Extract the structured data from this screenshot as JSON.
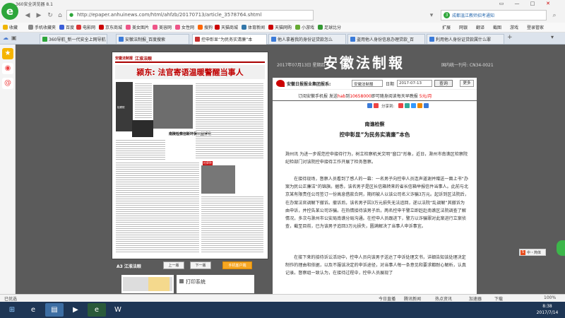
{
  "browser": {
    "title": "360安全浏览器 8.1",
    "url": "http://epaper.anhuinews.com/html/ahfzb/20170713/article_3578764.shtml",
    "search_query": "成都温江教师招考通知",
    "window_controls": [
      "▭",
      "—",
      "□",
      "✕"
    ]
  },
  "bookmarks": {
    "label": "收藏",
    "items": [
      "手机收藏夹",
      "百度",
      "电影网",
      "京东商城",
      "美女图片",
      "美容网",
      "女性网",
      "搜狗",
      "天猫商城",
      "体育新闻",
      "天猫网购",
      "小游戏",
      "足球比分"
    ],
    "right_items": [
      "扩展",
      "网银",
      "翻译",
      "截图",
      "游戏",
      "登录管家"
    ]
  },
  "tabs": [
    {
      "label": "360导航_新一代安全上网导航",
      "active": false,
      "color": "#2da63a"
    },
    {
      "label": "安徽法制报_百度搜索",
      "active": false,
      "color": "#3b7bd9"
    },
    {
      "label": "控申彰显“为民务实清廉”本",
      "active": true,
      "color": "#c83232"
    },
    {
      "label": "他人拿着我的身份证贷款怎么",
      "active": false,
      "color": "#3b7bd9"
    },
    {
      "label": "盗用他人身份信息办理贷款_百",
      "active": false,
      "color": "#3b7bd9"
    },
    {
      "label": "利用他人身份证贷款属什么罪",
      "active": false,
      "color": "#3b7bd9"
    }
  ],
  "sidebar_icons": [
    "star-icon",
    "weibo-icon",
    "mail-icon"
  ],
  "newspaper": {
    "masthead_left": "安徽法制报",
    "masthead_section": "江淮法眼",
    "headline": "颍东: 法官寄语温暖警醒当事人",
    "sub_headline": "南陵检察创新环保公益诉讼",
    "photo_tag": "检察院",
    "side_caption": "检察院连续上门走访对接小微企业"
  },
  "page_controls": {
    "page_label": "A3 江淮法眼",
    "prev": "上一版",
    "next": "下一版",
    "mobile": "手机客户端"
  },
  "print_label": "打印系统",
  "site_header": {
    "date": "2017年07月13日 星期四",
    "brand": "安徽法制報",
    "cn": "国内统一刊号: CN34-0021"
  },
  "toolrow": {
    "publisher": "安徽日报报业集团报系:",
    "select_value": "安徽法制报",
    "date_label": "日期",
    "date_value": "2017-07-13",
    "query_button": "查询",
    "more_button": "更多"
  },
  "promo": {
    "text": "订阅安徽手机报  发送",
    "code": "hab",
    "mid": "到",
    "number": "10658000",
    "tail": "即可随身阅读每天早晚报",
    "price": "5元/月"
  },
  "article": {
    "share_label": "分享到:",
    "pretitle": "南谯检察",
    "title": "控申彰显“为民务实清廉”本色",
    "paragraphs": [
      "滁州讯 为进一步规范控申接待行为，树立检察机关文明“窗口”形象，近日，滁州市南谯区检察院纪检部门对该院控申接待工作开展了检务督察。",
      "在接待现场，督察人员看到了感人的一幕：一名男子向控申人员连声道谢并赠送一面上书“办案为民公正廉洁”的锦旗。据悉，该名男子是区长信箱转来的省长信箱举报信件当事人。此前与北京某有限责任公司签订一份高息借款合同，期间被人以该公司名义诈骗3万元。起诉到区法院后，在办案法官调解下撤诉。撤诉后，该名男子因3万元损失无法追回，遂以法院“乱调解”其撤诉为由申诉，并控告某公司诈骗。在热情接待该男子后，两名控申干警立即赶赴南谯区法院调查了解情况，多次与滁州市公安局南谯分局沟通。在控申人员跟进下，警方以诈骗罪对此案进行立案侦查，截至目前，已为该男子追回3万元损失，圆满解决了当事人申诉事宜。",
      "在接下来的接待诉讼活动中，控申人员向该男子送达了申诉处理文书，详细告知该处理决定制作的理由和依据，以及不服该决定的申诉途径，对当事人每一条意见和要求都耐心解析，认真记录。督察组一致认为，在接待过程中，控申人员展现了"
    ]
  },
  "sogou": "中・简体",
  "status": {
    "left": "已优选",
    "items": [
      "今日直播",
      "腾讯新闻",
      "热点资讯",
      "加速器",
      "下载",
      "100%"
    ]
  },
  "taskbar": {
    "time": "8:38",
    "date": "2017/7/14"
  }
}
